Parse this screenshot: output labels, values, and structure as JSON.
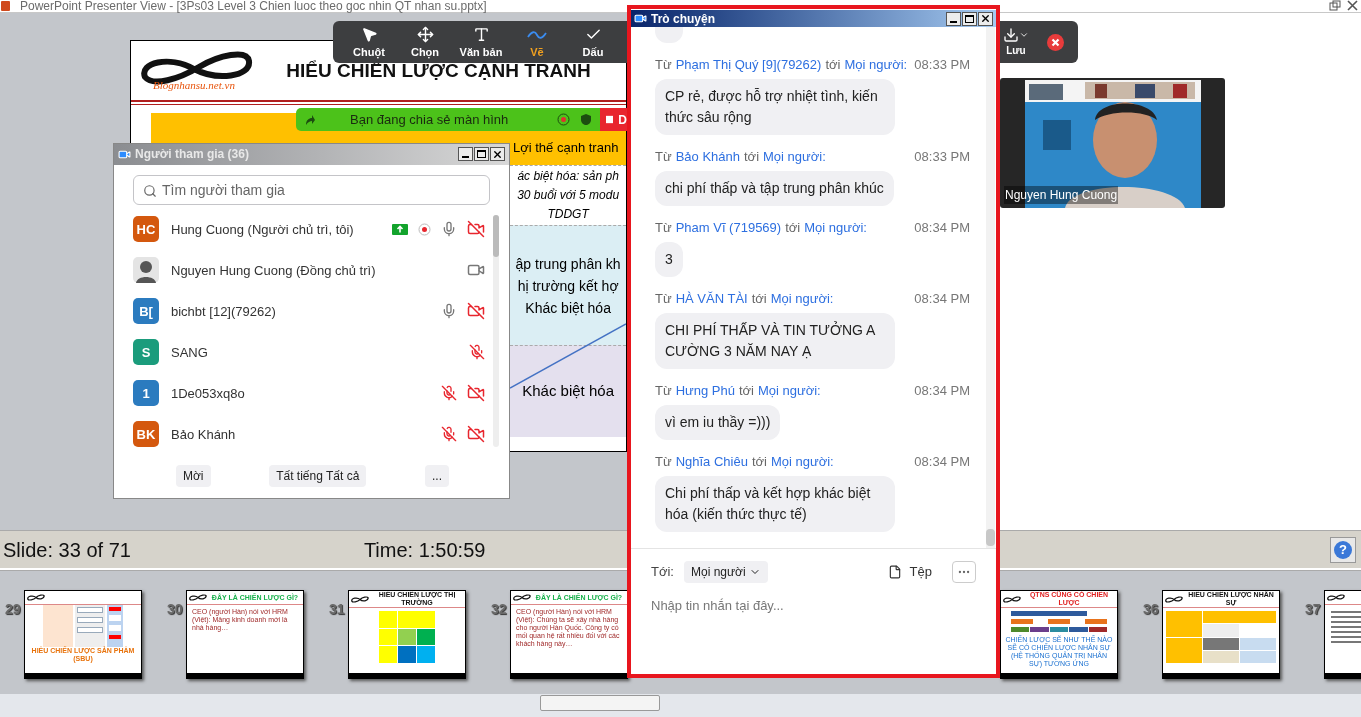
{
  "window": {
    "title": "PowerPoint Presenter View - [3Ps03 Level 3 Chien luoc theo goc nhin QT nhan su.pptx]"
  },
  "slide": {
    "logo": "Blognhansu.net.vn",
    "title": "HIỂU CHIẾN LƯỢC CẠNH TRANH",
    "header": "Lợi thế cạnh tranh",
    "cells": [
      {
        "color": "#ffffff",
        "italic": true,
        "lines": [
          "ác biệt hóa: sản ph",
          "30 buổi với 5 modu",
          "TDDGT"
        ]
      },
      {
        "color": "#dbeef4",
        "italic": false,
        "lines": [
          "ập trung phân kh",
          "hị trường kết hợ",
          "Khác biệt hóa"
        ]
      },
      {
        "color": "#e4e0ee",
        "italic": false,
        "lines": [
          "Khác biệt hóa"
        ]
      }
    ]
  },
  "annotation_toolbar": {
    "tools": [
      {
        "kind": "pointer",
        "label": "Chuột",
        "selected": false
      },
      {
        "kind": "move",
        "label": "Chọn",
        "selected": false
      },
      {
        "kind": "text",
        "label": "Văn bản",
        "selected": false
      },
      {
        "kind": "draw",
        "label": "Vẽ",
        "selected": true
      },
      {
        "kind": "check",
        "label": "Dấu",
        "selected": false
      }
    ],
    "save_label": "Lưu"
  },
  "share_banner": {
    "text": "Bạn đang chia sẻ màn hình",
    "stop_label": "D"
  },
  "participants": {
    "title": "Người tham gia (36)",
    "search_placeholder": "Tìm người tham gia",
    "list": [
      {
        "name": "Hung Cuong (Người chủ trì, tôi)",
        "avatar": {
          "kind": "initials",
          "text": "HC",
          "color": "#d4580e"
        },
        "sharing": true,
        "recording": true,
        "mic_muted": false,
        "video_off": true
      },
      {
        "name": "Nguyen Hung Cuong (Đồng chủ trì)",
        "sharing": false,
        "recording": false,
        "video_off": false
      },
      {
        "name": "bichbt [12](79262)",
        "avatar": {
          "kind": "initials",
          "text": "B[",
          "color": "#2b7bbf"
        },
        "sharing": false,
        "recording": false,
        "mic_muted": false,
        "video_off": true
      },
      {
        "name": "SANG",
        "avatar": {
          "kind": "initials",
          "text": "S",
          "color": "#1b9c7c"
        },
        "sharing": false,
        "recording": false,
        "mic_muted": true
      },
      {
        "name": "1De053xq8o",
        "avatar": {
          "kind": "initials",
          "text": "1",
          "color": "#2b7bbf"
        },
        "sharing": false,
        "recording": false,
        "mic_muted": true,
        "video_off": true
      },
      {
        "name": "Bảo Khánh",
        "avatar": {
          "kind": "initials",
          "text": "BK",
          "color": "#d4580e"
        },
        "sharing": false,
        "recording": false,
        "mic_muted": true,
        "video_off": true
      }
    ],
    "buttons": [
      "Mời",
      "Tất tiếng Tất cả",
      "..."
    ]
  },
  "chat": {
    "title": "Trò chuyện",
    "messages": [
      {
        "from_label": "Từ",
        "sender": "Phạm Thị Quý [9](79262)",
        "to_label": "tới",
        "recipient": "Mọi người:",
        "time": "08:33 PM",
        "text": "CP rẻ, được hỗ trợ nhiệt tình, kiến thức sâu rộng"
      },
      {
        "from_label": "Từ",
        "sender": "Bảo Khánh",
        "to_label": "tới",
        "recipient": "Mọi người:",
        "time": "08:33 PM",
        "text": "chi phí thấp và tập trung phân khúc"
      },
      {
        "from_label": "Từ",
        "sender": "Pham Vĩ (719569)",
        "to_label": "tới",
        "recipient": "Mọi người:",
        "time": "08:34 PM",
        "text": "3"
      },
      {
        "from_label": "Từ",
        "sender": "HÀ VĂN TÀI",
        "to_label": "tới",
        "recipient": "Mọi người:",
        "time": "08:34 PM",
        "text": "CHI PHÍ THẤP VÀ TIN TƯỞNG A CƯỜNG 3 NĂM NAY Ạ"
      },
      {
        "from_label": "Từ",
        "sender": "Hưng Phú",
        "to_label": "tới",
        "recipient": "Mọi người:",
        "time": "08:34 PM",
        "text": "vì em iu thầy =)))"
      },
      {
        "from_label": "Từ",
        "sender": "Nghĩa Chiêu",
        "to_label": "tới",
        "recipient": "Mọi người:",
        "time": "08:34 PM",
        "text": "Chi phí thấp và kết hợp khác biệt hóa (kiến thức thực tế)"
      }
    ],
    "to_label": "Tới:",
    "recipient": "Mọi người",
    "file_label": "Tệp",
    "placeholder": "Nhập tin nhắn tại đây..."
  },
  "video": {
    "name": "Nguyen Hung Cuong"
  },
  "status": {
    "slide_counter": "Slide: 33 of 71",
    "timer": "Time: 1:50:59",
    "help": "?"
  },
  "thumbnails_left": [
    {
      "number": "29",
      "kind": "diagram",
      "title": "HIỂU CHIẾN LƯỢC SẢN PHẨM (SBU)",
      "color": "#e8730c"
    },
    {
      "number": "30",
      "kind": "text",
      "title": "ĐÂY LÀ CHIẾN LƯỢC GÌ?",
      "color": "#16b04a",
      "body": "CEO (người Hàn) nói với HRM (Việt): Mảng kinh doanh mới là nhà hàng…"
    },
    {
      "number": "31",
      "kind": "matrix",
      "title": "HIỂU CHIẾN LƯỢC THỊ TRƯỜNG",
      "color": "#111111"
    },
    {
      "number": "32",
      "kind": "text",
      "title": "ĐÂY LÀ CHIẾN LƯỢC GÌ?",
      "color": "#16b04a",
      "body": "CEO (người Hàn) nói với HRM (Việt): Chúng ta sẽ xây nhà hàng cho người Hàn Quốc. Công ty có mối quan hệ rất nhiều đối với các khách hàng này…"
    }
  ],
  "thumbnails_right": [
    {
      "kind": "org",
      "title": "QTNS CŨNG CÓ CHIẾN LƯỢC",
      "color": "#e02020",
      "body": "CHIẾN LƯỢC SẼ NHƯ THẾ NÀO SẼ CÓ CHIẾN LƯỢC NHÂN SỰ (HỆ THỐNG QUẢN TRỊ NHÂN SỰ) TƯƠNG ỨNG"
    },
    {
      "number": "36",
      "kind": "table",
      "title": "HIỂU CHIẾN LƯỢC NHÂN SỰ",
      "color": "#111111"
    },
    {
      "number": "37",
      "kind": "lines"
    }
  ]
}
